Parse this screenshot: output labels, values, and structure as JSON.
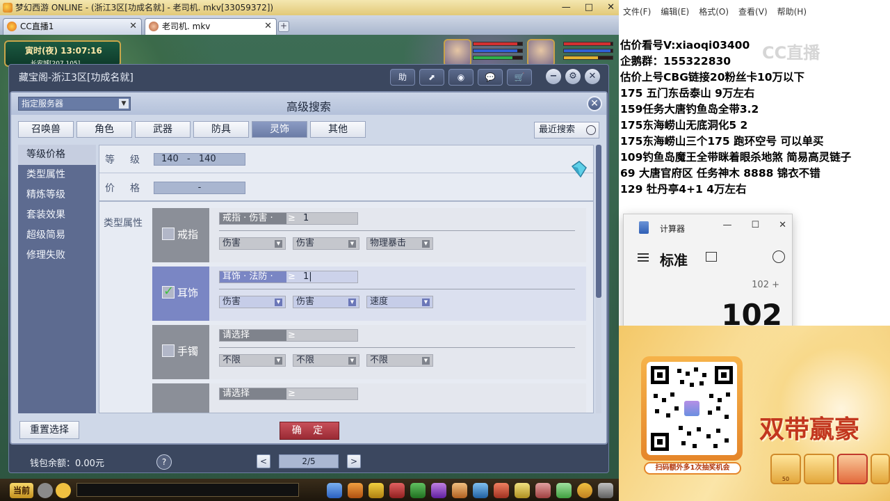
{
  "window": {
    "title": "梦幻西游 ONLINE - (浙江3区[功成名就] - 老司机. mkv[33059372])",
    "controls": [
      "—",
      "□",
      "✕"
    ]
  },
  "browser_tabs": [
    {
      "label": "CC直播1",
      "close": "✕"
    },
    {
      "label": "老司机. mkv",
      "close": "✕"
    }
  ],
  "tab_plus": "+",
  "hud": {
    "time": "寅时(夜)  13:07:16",
    "coords": "长安城[207,105]"
  },
  "cbg": {
    "title": "藏宝阁-浙江3区[功成名就]",
    "tools": [
      "助",
      "⬈",
      "◉",
      "💬",
      "🛒"
    ],
    "win_controls": [
      "−",
      "⚙",
      "✕"
    ],
    "wallet": "钱包余额：0.00元",
    "help": "?",
    "pager": {
      "prev": "<",
      "page": "2/5",
      "next": ">"
    }
  },
  "advanced_search": {
    "title": "高级搜索",
    "server_select": "指定服务器",
    "close": "✕",
    "categories": [
      {
        "label": "召唤兽",
        "active": false
      },
      {
        "label": "角色",
        "active": false
      },
      {
        "label": "武器",
        "active": false
      },
      {
        "label": "防具",
        "active": false
      },
      {
        "label": "灵饰",
        "active": true
      },
      {
        "label": "其他",
        "active": false
      }
    ],
    "recent_search": "最近搜索",
    "side_nav": [
      {
        "label": "等级价格",
        "active": true
      },
      {
        "label": "类型属性",
        "active": false
      },
      {
        "label": "精炼等级",
        "active": false
      },
      {
        "label": "套装效果",
        "active": false
      },
      {
        "label": "超级简易",
        "active": false
      },
      {
        "label": "修理失败",
        "active": false
      }
    ],
    "level": {
      "label": "等　级",
      "min": "140",
      "sep": "-",
      "max": "140"
    },
    "price": {
      "label": "价　格",
      "sep": "-"
    },
    "attr_label": "类型属性",
    "attr_rows": [
      {
        "name": "戒指",
        "checked": false,
        "main": "戒指 · 伤害 ·",
        "op": "≥",
        "value": "1",
        "subs": [
          "伤害",
          "伤害",
          "物理暴击"
        ]
      },
      {
        "name": "耳饰",
        "checked": true,
        "main": "耳饰 · 法防 ·",
        "op": "≥",
        "value": "1|",
        "subs": [
          "伤害",
          "伤害",
          "速度"
        ]
      },
      {
        "name": "手镯",
        "checked": false,
        "main": "请选择",
        "op": "≥",
        "value": "",
        "subs": [
          "不限",
          "不限",
          "不限"
        ]
      },
      {
        "name": "",
        "checked": false,
        "main": "请选择",
        "op": "≥",
        "value": "",
        "subs": []
      }
    ],
    "reset": "重置选择",
    "confirm": "确 定"
  },
  "game_bottom": {
    "channel": "当前"
  },
  "notepad": {
    "menu": [
      "文件(F)",
      "编辑(E)",
      "格式(O)",
      "查看(V)",
      "帮助(H)"
    ],
    "lines": [
      "估价看号V:xiaoqi03400",
      "企鹅群：155322830",
      "估价上号CBG链接20粉丝卡10万以下",
      "175 五门东岳泰山  9万左右",
      "159任务大唐钓鱼岛全带3.2",
      "175东海崂山无底洞化5  2",
      "175东海崂山三个175 跑环空号 可以单买",
      "109钓鱼岛魔王全带眯着眼杀地煞 简易高灵链子",
      "69  大唐官府区 任务神木 8888 锦衣不错",
      "129 牡丹亭4+1 4万左右"
    ],
    "watermark": "CC直播"
  },
  "calculator": {
    "title": "计算器",
    "mode": "标准",
    "expression": "102 +",
    "display": "102",
    "controls": [
      "—",
      "☐",
      "✕"
    ]
  },
  "promo": {
    "qr_caption": "扫码额外多1次抽奖机会",
    "slogan": "双带赢豪",
    "prizes": [
      "50",
      "",
      "",
      ""
    ]
  },
  "colors": {
    "panel_bg": "#3b475f",
    "dialog_bg": "#cfd8e8",
    "active_tab": "#6b7ca6",
    "confirm": "#9a2a34",
    "checked_row": "#7a86c4"
  }
}
